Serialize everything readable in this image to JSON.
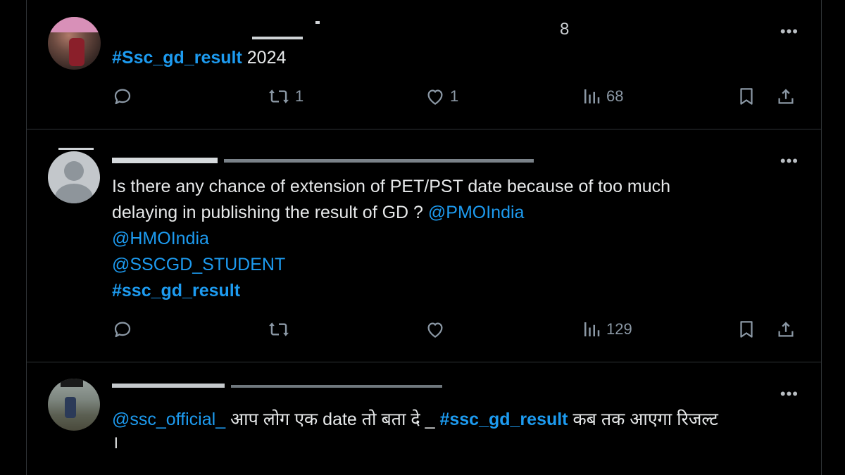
{
  "posts": [
    {
      "stray_char": "8",
      "hashtag": "#Ssc_gd_result",
      "after_text": " 2024",
      "more_label": "•••",
      "counts": {
        "replies": "",
        "reposts": "1",
        "likes": "1",
        "views": "68"
      }
    },
    {
      "more_label": "•••",
      "text_line1": "Is there any chance of extension of PET/PST date because of too much",
      "text_line2": "delaying in publishing the result of GD ? ",
      "mention1": "@PMOIndia",
      "mention2": "@HMOIndia",
      "mention3": "@SSCGD_STUDENT",
      "hashtag": "#ssc_gd_result",
      "counts": {
        "replies": "",
        "reposts": "",
        "likes": "",
        "views": "129"
      }
    },
    {
      "more_label": "•••",
      "mention": "@ssc_official_",
      "text_mid": " आप लोग एक date तो बता दे _ ",
      "hashtag": "#ssc_gd_result",
      "text_end": " कब तक आएगा रिजल्ट",
      "text_line2": "।"
    }
  ],
  "icons": [
    "reply-icon",
    "repost-icon",
    "like-icon",
    "views-icon",
    "bookmark-icon",
    "share-icon"
  ],
  "colors": {
    "background": "#000000",
    "text": "#e7e9ea",
    "link": "#1d9bf0",
    "muted": "#8b98a5",
    "divider": "#2f3336"
  }
}
